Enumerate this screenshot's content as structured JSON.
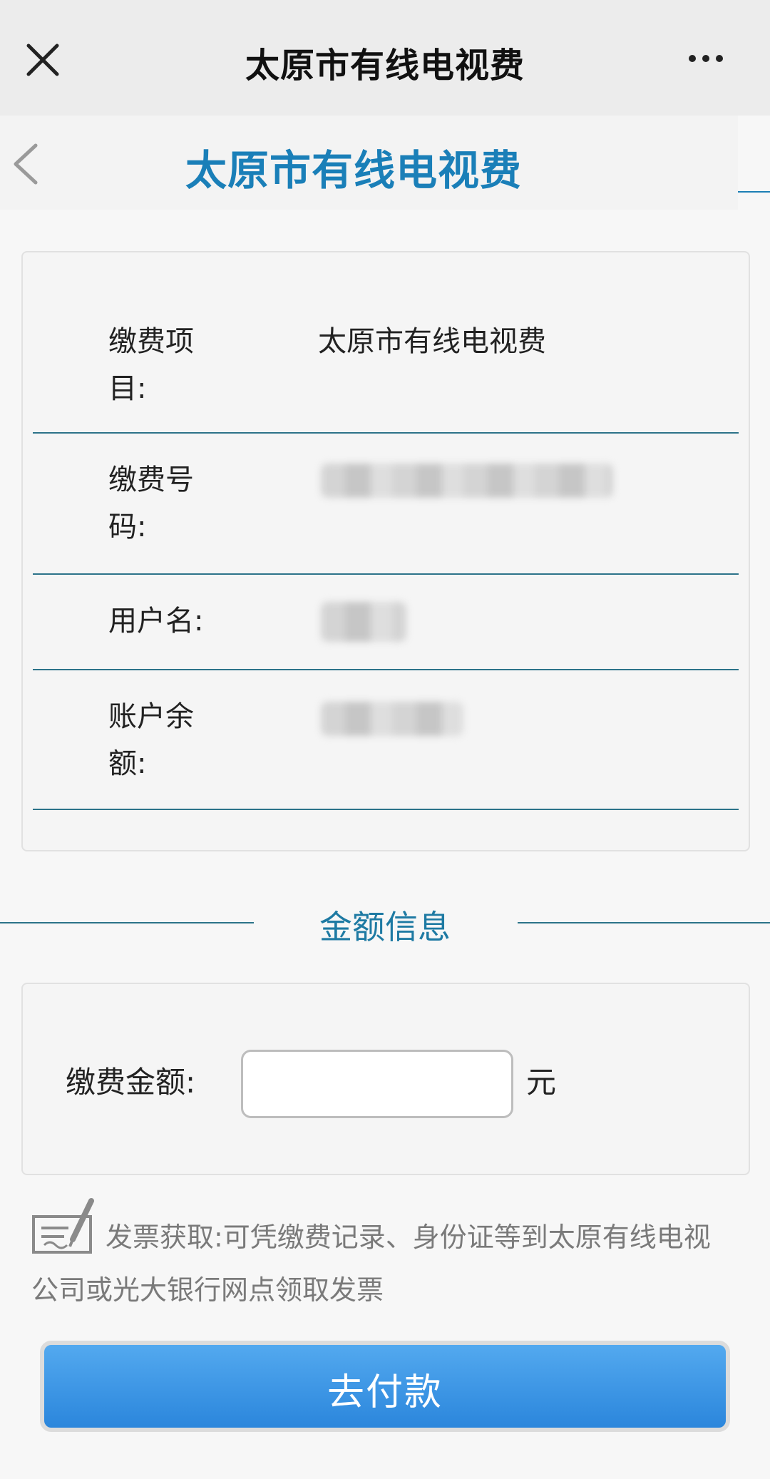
{
  "topbar": {
    "title": "太原市有线电视费"
  },
  "header": {
    "title": "太原市有线电视费"
  },
  "info": {
    "rows": [
      {
        "label": "缴费项目:",
        "value": "太原市有线电视费"
      },
      {
        "label": "缴费号码:"
      },
      {
        "label": "用户名:"
      },
      {
        "label": "账户余额:"
      }
    ]
  },
  "amount_section": {
    "title": "金额信息",
    "label": "缴费金额:",
    "value": "",
    "unit": "元"
  },
  "invoice": {
    "text": "发票获取:可凭缴费记录、身份证等到太原有线电视公司或光大银行网点领取发票"
  },
  "pay_button": {
    "label": "去付款"
  },
  "colors": {
    "accent": "#1a7fb8",
    "divider": "#2c7389",
    "button": "#2b86dc"
  }
}
